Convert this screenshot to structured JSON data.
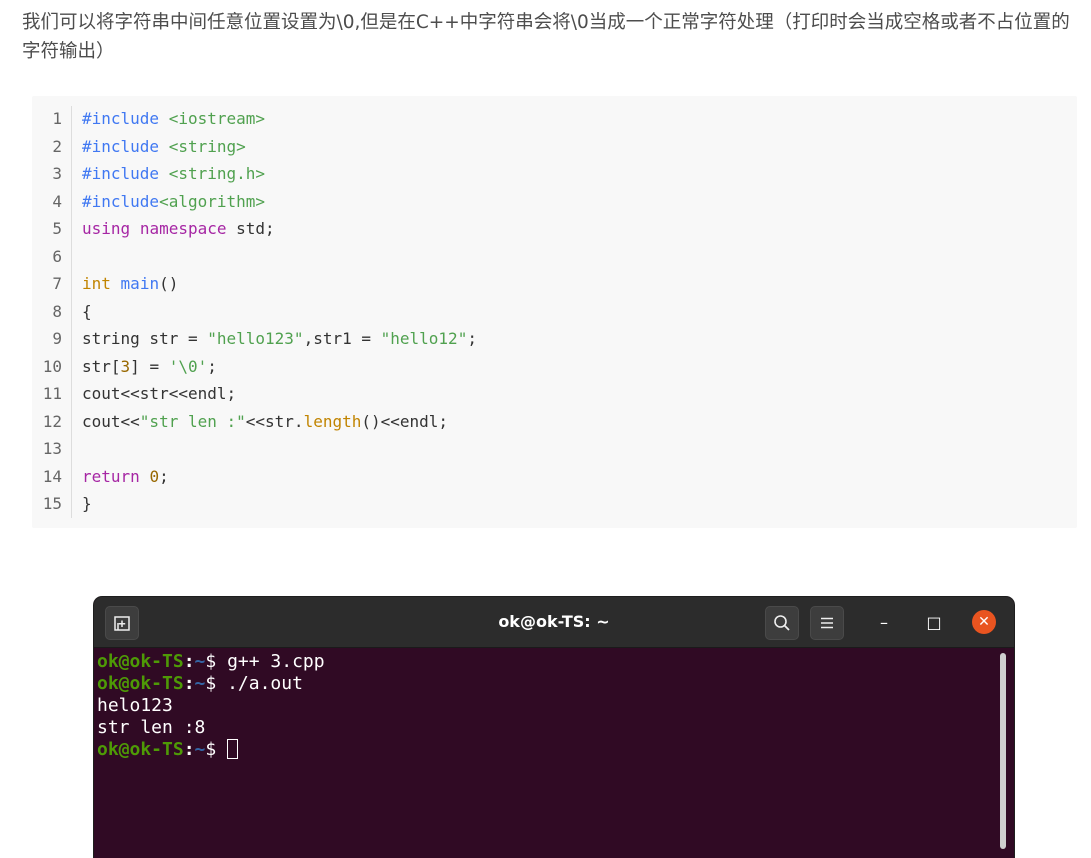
{
  "intro": {
    "text": "我们可以将字符串中间任意位置设置为\\0,但是在C++中字符串会将\\0当成一个正常字符处理（打印时会当成空格或者不占位置的字符输出）"
  },
  "code": {
    "lines": [
      {
        "num": "1",
        "parts": [
          {
            "t": "#include ",
            "c": "t-meta"
          },
          {
            "t": "<iostream>",
            "c": "t-str"
          }
        ]
      },
      {
        "num": "2",
        "parts": [
          {
            "t": "#include ",
            "c": "t-meta"
          },
          {
            "t": "<string>",
            "c": "t-str"
          }
        ]
      },
      {
        "num": "3",
        "parts": [
          {
            "t": "#include ",
            "c": "t-meta"
          },
          {
            "t": "<string.h>",
            "c": "t-str"
          }
        ]
      },
      {
        "num": "4",
        "parts": [
          {
            "t": "#include",
            "c": "t-meta"
          },
          {
            "t": "<algorithm>",
            "c": "t-str"
          }
        ]
      },
      {
        "num": "5",
        "parts": [
          {
            "t": "using",
            "c": "t-kw"
          },
          {
            "t": " "
          },
          {
            "t": "namespace",
            "c": "t-kw"
          },
          {
            "t": " std;"
          }
        ]
      },
      {
        "num": "6",
        "parts": []
      },
      {
        "num": "7",
        "parts": [
          {
            "t": "int",
            "c": "t-type"
          },
          {
            "t": " "
          },
          {
            "t": "main",
            "c": "t-func"
          },
          {
            "t": "()"
          }
        ]
      },
      {
        "num": "8",
        "parts": [
          {
            "t": "{"
          }
        ]
      },
      {
        "num": "9",
        "parts": [
          {
            "t": "string str = "
          },
          {
            "t": "\"hello123\"",
            "c": "t-str"
          },
          {
            "t": ",str1 = "
          },
          {
            "t": "\"hello12\"",
            "c": "t-str"
          },
          {
            "t": ";"
          }
        ]
      },
      {
        "num": "10",
        "parts": [
          {
            "t": "str["
          },
          {
            "t": "3",
            "c": "t-num"
          },
          {
            "t": "] = "
          },
          {
            "t": "'\\0'",
            "c": "t-str"
          },
          {
            "t": ";"
          }
        ]
      },
      {
        "num": "11",
        "parts": [
          {
            "t": "cout<<str<<endl;"
          }
        ]
      },
      {
        "num": "12",
        "parts": [
          {
            "t": "cout<<"
          },
          {
            "t": "\"str len :\"",
            "c": "t-str"
          },
          {
            "t": "<<str."
          },
          {
            "t": "length",
            "c": "t-type"
          },
          {
            "t": "()<<endl;"
          }
        ]
      },
      {
        "num": "13",
        "parts": []
      },
      {
        "num": "14",
        "parts": [
          {
            "t": "return",
            "c": "t-kw"
          },
          {
            "t": " "
          },
          {
            "t": "0",
            "c": "t-num"
          },
          {
            "t": ";"
          }
        ]
      },
      {
        "num": "15",
        "parts": [
          {
            "t": "}"
          }
        ]
      }
    ]
  },
  "terminal": {
    "title": "ok@ok-TS: ~",
    "new_tab_icon": "new-tab-icon",
    "search_icon": "search-icon",
    "menu_icon": "hamburger-menu-icon",
    "minimize_glyph": "–",
    "maximize_glyph": "□",
    "close_glyph": "✕",
    "prompt_user": "ok@ok-TS",
    "prompt_sep": ":",
    "prompt_path": "~",
    "prompt_symbol": "$ ",
    "lines": [
      {
        "prompt": true,
        "text": "g++ 3.cpp"
      },
      {
        "prompt": true,
        "text": "./a.out"
      },
      {
        "prompt": false,
        "text": "helo123"
      },
      {
        "prompt": false,
        "text": "str len :8"
      },
      {
        "prompt": true,
        "text": "",
        "cursor": true
      }
    ],
    "colors": {
      "background": "#300a24",
      "user": "#4e9a06",
      "path": "#3465a4",
      "close": "#e95420"
    }
  }
}
